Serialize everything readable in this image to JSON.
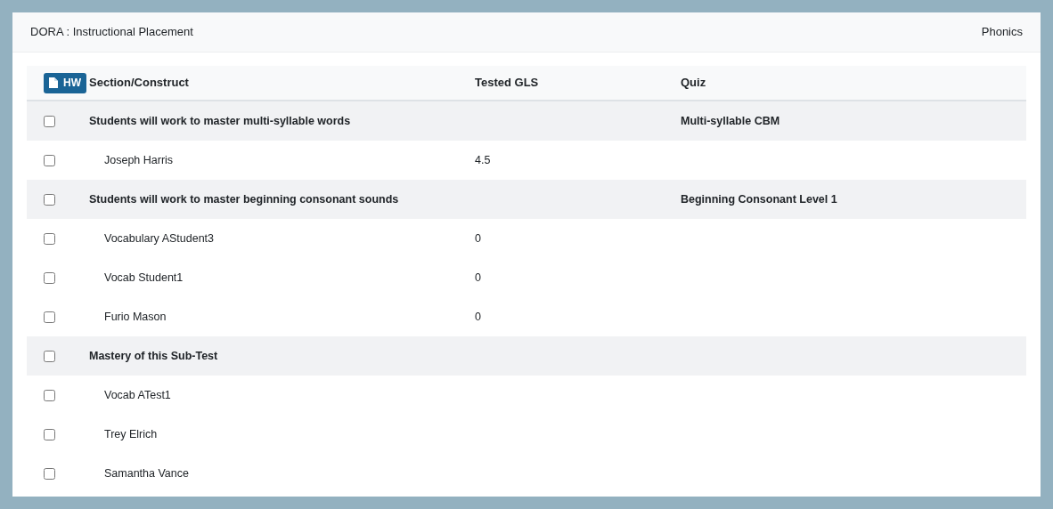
{
  "header": {
    "title": "DORA : Instructional Placement",
    "subject": "Phonics"
  },
  "toolbar": {
    "hw_button": "HW"
  },
  "table": {
    "columns": [
      "Section/Construct",
      "Tested GLS",
      "Quiz"
    ],
    "rows": [
      {
        "kind": "group",
        "checked": false,
        "label": "Students will work to master multi-syllable words",
        "quiz": "Multi-syllable CBM"
      },
      {
        "kind": "student",
        "checked": false,
        "label": "Joseph Harris",
        "gls": "4.5"
      },
      {
        "kind": "group",
        "checked": false,
        "label": "Students will work to master beginning consonant sounds",
        "quiz": "Beginning Consonant Level 1"
      },
      {
        "kind": "student",
        "checked": false,
        "label": "Vocabulary AStudent3",
        "gls": "0"
      },
      {
        "kind": "student",
        "checked": false,
        "label": "Vocab Student1",
        "gls": "0"
      },
      {
        "kind": "student",
        "checked": false,
        "label": "Furio Mason",
        "gls": "0"
      },
      {
        "kind": "group",
        "checked": false,
        "label": "Mastery of this Sub-Test"
      },
      {
        "kind": "student",
        "checked": false,
        "label": "Vocab ATest1"
      },
      {
        "kind": "student",
        "checked": false,
        "label": "Trey Elrich"
      },
      {
        "kind": "student",
        "checked": false,
        "label": "Samantha Vance"
      }
    ]
  }
}
